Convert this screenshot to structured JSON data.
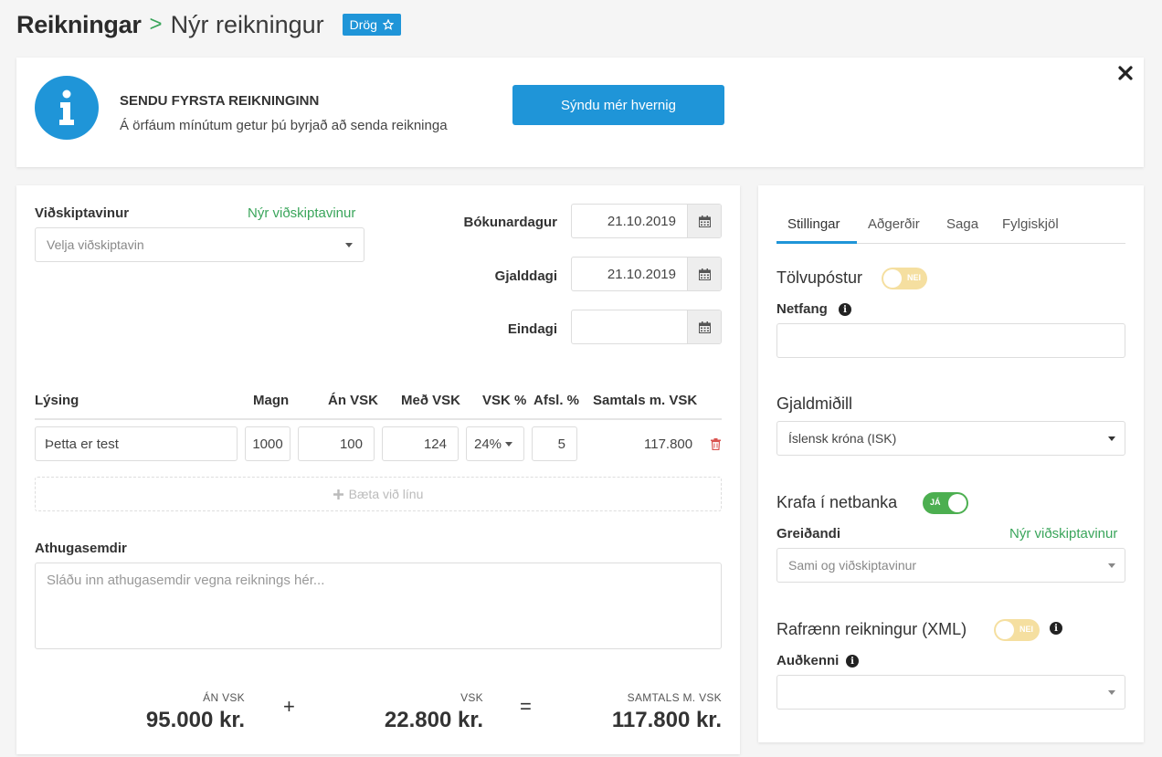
{
  "breadcrumb": {
    "root": "Reikningar",
    "separator": ">",
    "current": "Nýr reikningur",
    "badge": "Drög"
  },
  "banner": {
    "title": "SENDU FYRSTA REIKNINGINN",
    "text": "Á örfáum mínútum getur þú byrjað að senda reikninga",
    "button": "Sýndu mér hvernig"
  },
  "customer": {
    "label": "Viðskiptavinur",
    "new_link": "Nýr viðskiptavinur",
    "placeholder": "Velja viðskiptavin"
  },
  "dates": {
    "booking": {
      "label": "Bókunardagur",
      "value": "21.10.2019"
    },
    "due": {
      "label": "Gjalddagi",
      "value": "21.10.2019"
    },
    "final": {
      "label": "Eindagi",
      "value": ""
    }
  },
  "lines": {
    "headers": [
      "Lýsing",
      "Magn",
      "Án VSK",
      "Með VSK",
      "VSK %",
      "Afsl. %",
      "Samtals m. VSK"
    ],
    "rows": [
      {
        "description": "Þetta er test",
        "qty": "1000",
        "net": "100",
        "gross": "124",
        "vat": "24%",
        "discount": "5",
        "total": "117.800"
      }
    ],
    "add_line": "Bæta við línu"
  },
  "notes": {
    "label": "Athugasemdir",
    "placeholder": "Sláðu inn athugasemdir vegna reiknings hér..."
  },
  "summary": {
    "net_label": "ÁN VSK",
    "net_value": "95.000 kr.",
    "plus": "+",
    "vat_label": "VSK",
    "vat_value": "22.800 kr.",
    "equals": "=",
    "total_label": "SAMTALS M. VSK",
    "total_value": "117.800 kr."
  },
  "side": {
    "tabs": [
      "Stillingar",
      "Aðgerðir",
      "Saga",
      "Fylgiskjöl"
    ],
    "email": {
      "title": "Tölvupóstur",
      "toggle": "NEI",
      "field_label": "Netfang",
      "value": ""
    },
    "currency": {
      "title": "Gjaldmiðill",
      "value": "Íslensk króna (ISK)"
    },
    "bank_claim": {
      "title": "Krafa í netbanka",
      "toggle": "JÁ",
      "payer_label": "Greiðandi",
      "new_link": "Nýr viðskiptavinur",
      "payer_value": "Sami og viðskiptavinur"
    },
    "xml": {
      "title": "Rafrænn reikningur (XML)",
      "toggle": "NEI",
      "id_label": "Auðkenni",
      "value": ""
    }
  },
  "colors": {
    "accent": "#1f95d8",
    "green": "#3aa55b",
    "toggle_off": "#f5dfa0",
    "toggle_on": "#4caf50",
    "delete": "#d9534f"
  }
}
